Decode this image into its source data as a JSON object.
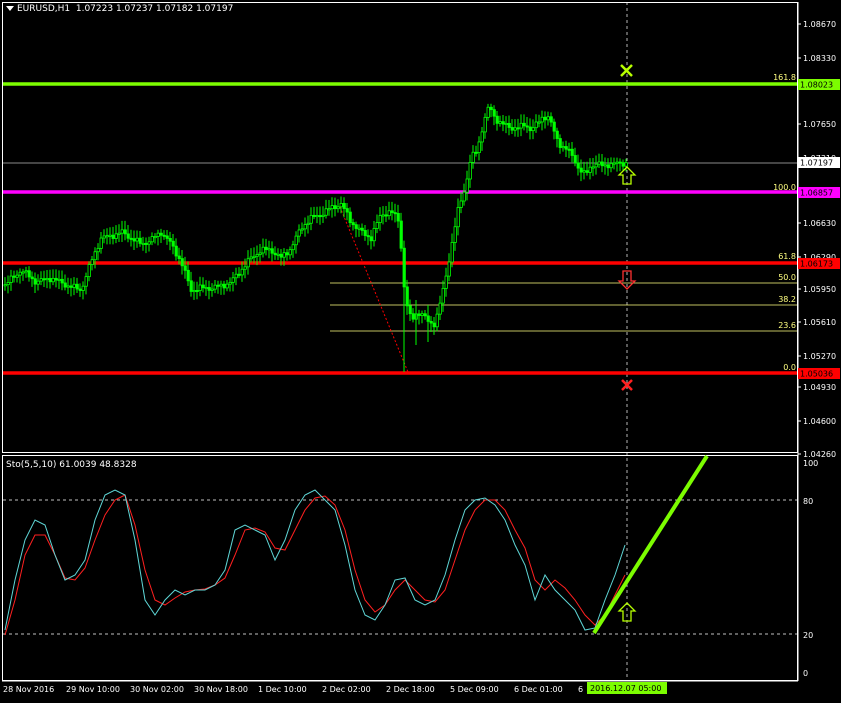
{
  "header": {
    "symbol": "EURUSD,H1",
    "ohlc": "1.07223 1.07237 1.07182 1.07197"
  },
  "indicator": {
    "title": "Sto(5,5,10) 61.0039 48.8328",
    "axis_labels": [
      "100",
      "80",
      "20",
      "0"
    ]
  },
  "price_axis": {
    "labels": [
      "1.08670",
      "1.08330",
      "1.07650",
      "1.07310",
      "1.06970",
      "1.06630",
      "1.06290",
      "1.05950",
      "1.05610",
      "1.05270",
      "1.04930",
      "1.04600",
      "1.04260"
    ],
    "current_price": "1.07197"
  },
  "levels": [
    {
      "id": "fib-161",
      "pct": "161.8",
      "price": "1.08023",
      "color": "#7cfc00"
    },
    {
      "id": "fib-100",
      "pct": "100.0",
      "price": "1.06857",
      "color": "#ff00ff"
    },
    {
      "id": "fib-61",
      "pct": "61.8",
      "price": "1.06173",
      "color": "#ff0000"
    },
    {
      "id": "fib-50",
      "pct": "50.0",
      "price": "",
      "color": "#ffff80"
    },
    {
      "id": "fib-38",
      "pct": "38.2",
      "price": "",
      "color": "#ffff80"
    },
    {
      "id": "fib-23",
      "pct": "23.6",
      "price": "",
      "color": "#ffff80"
    },
    {
      "id": "fib-0",
      "pct": "0.0",
      "price": "1.05036",
      "color": "#ff0000"
    }
  ],
  "time_axis": {
    "labels": [
      "28 Nov 2016",
      "29 Nov 10:00",
      "30 Nov 02:00",
      "30 Nov 18:00",
      "1 Dec 10:00",
      "2 Dec 02:00",
      "2 Dec 18:00",
      "5 Dec 09:00",
      "6 Dec 01:00",
      "6"
    ],
    "cursor_label": "2016.12.07 05:00"
  },
  "colors": {
    "candles": "#00ff00",
    "stoch_main": "#5fd7d7",
    "stoch_signal": "#ff2020",
    "trendline": "#7cfc00"
  },
  "icons": {
    "menu": "triangle-down-icon",
    "up_arrows": "up-arrow-icon",
    "down_arrow": "down-arrow-icon",
    "take_profit": "cross-icon",
    "stop_loss": "cross-icon"
  }
}
